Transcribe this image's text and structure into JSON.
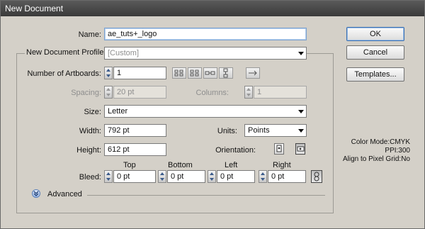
{
  "window": {
    "title": "New Document"
  },
  "name": {
    "label": "Name:",
    "value": "ae_tuts+_logo"
  },
  "profile": {
    "label": "New Document Profile:",
    "value": "[Custom]"
  },
  "artboards": {
    "label": "Number of Artboards:",
    "value": "1"
  },
  "spacing": {
    "label": "Spacing:",
    "value": "20 pt"
  },
  "columns": {
    "label": "Columns:",
    "value": "1"
  },
  "size": {
    "label": "Size:",
    "value": "Letter"
  },
  "width": {
    "label": "Width:",
    "value": "792 pt"
  },
  "units": {
    "label": "Units:",
    "value": "Points"
  },
  "height": {
    "label": "Height:",
    "value": "612 pt"
  },
  "orientation": {
    "label": "Orientation:",
    "selected": "landscape"
  },
  "bleed": {
    "label": "Bleed:",
    "top": {
      "label": "Top",
      "value": "0 pt"
    },
    "bottom": {
      "label": "Bottom",
      "value": "0 pt"
    },
    "left": {
      "label": "Left",
      "value": "0 pt"
    },
    "right": {
      "label": "Right",
      "value": "0 pt"
    }
  },
  "advanced": {
    "label": "Advanced"
  },
  "buttons": {
    "ok": "OK",
    "cancel": "Cancel",
    "templates": "Templates..."
  },
  "info": {
    "color_mode": "Color Mode:CMYK",
    "ppi": "PPI:300",
    "align": "Align to Pixel Grid:No"
  }
}
